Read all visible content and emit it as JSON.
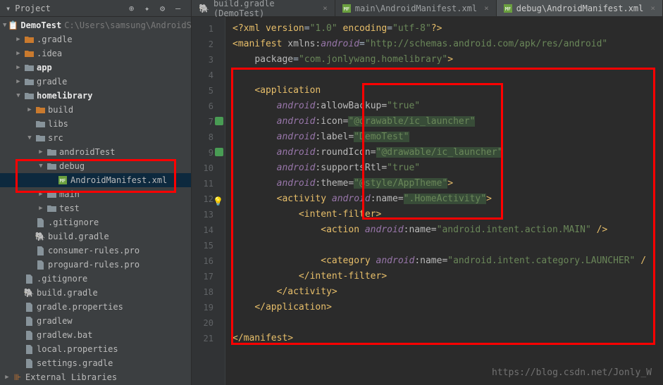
{
  "sidebar": {
    "title": "Project",
    "project": {
      "name": "DemoTest",
      "path": "C:\\Users\\samsung\\AndroidStu"
    },
    "nodes": [
      {
        "indent": 1,
        "arrow": "right",
        "icon": "folder-orange",
        "label": ".gradle"
      },
      {
        "indent": 1,
        "arrow": "right",
        "icon": "folder-orange",
        "label": ".idea"
      },
      {
        "indent": 1,
        "arrow": "right",
        "icon": "folder",
        "label": "app",
        "bold": true
      },
      {
        "indent": 1,
        "arrow": "right",
        "icon": "folder",
        "label": "gradle"
      },
      {
        "indent": 1,
        "arrow": "down",
        "icon": "folder",
        "label": "homelibrary",
        "bold": true
      },
      {
        "indent": 2,
        "arrow": "right",
        "icon": "folder-orange",
        "label": "build"
      },
      {
        "indent": 2,
        "arrow": "",
        "icon": "folder",
        "label": "libs"
      },
      {
        "indent": 2,
        "arrow": "down",
        "icon": "folder",
        "label": "src"
      },
      {
        "indent": 3,
        "arrow": "right",
        "icon": "folder",
        "label": "androidTest"
      },
      {
        "indent": 3,
        "arrow": "down",
        "icon": "folder",
        "label": "debug"
      },
      {
        "indent": 4,
        "arrow": "",
        "icon": "mf",
        "label": "AndroidManifest.xml",
        "selected": true
      },
      {
        "indent": 3,
        "arrow": "right",
        "icon": "folder",
        "label": "main"
      },
      {
        "indent": 3,
        "arrow": "right",
        "icon": "folder",
        "label": "test"
      },
      {
        "indent": 2,
        "arrow": "",
        "icon": "file",
        "label": ".gitignore"
      },
      {
        "indent": 2,
        "arrow": "",
        "icon": "gradle",
        "label": "build.gradle"
      },
      {
        "indent": 2,
        "arrow": "",
        "icon": "file",
        "label": "consumer-rules.pro"
      },
      {
        "indent": 2,
        "arrow": "",
        "icon": "file",
        "label": "proguard-rules.pro"
      },
      {
        "indent": 1,
        "arrow": "",
        "icon": "file",
        "label": ".gitignore"
      },
      {
        "indent": 1,
        "arrow": "",
        "icon": "gradle",
        "label": "build.gradle"
      },
      {
        "indent": 1,
        "arrow": "",
        "icon": "file",
        "label": "gradle.properties"
      },
      {
        "indent": 1,
        "arrow": "",
        "icon": "file",
        "label": "gradlew"
      },
      {
        "indent": 1,
        "arrow": "",
        "icon": "file",
        "label": "gradlew.bat"
      },
      {
        "indent": 1,
        "arrow": "",
        "icon": "file",
        "label": "local.properties"
      },
      {
        "indent": 1,
        "arrow": "",
        "icon": "file",
        "label": "settings.gradle"
      }
    ],
    "external": "External Libraries"
  },
  "tabs": [
    {
      "icon": "gradle",
      "label": "build.gradle (DemoTest)",
      "active": false
    },
    {
      "icon": "mf",
      "label": "main\\AndroidManifest.xml",
      "active": false
    },
    {
      "icon": "mf",
      "label": "debug\\AndroidManifest.xml",
      "active": true
    }
  ],
  "lines": [
    "1",
    "2",
    "3",
    "4",
    "5",
    "6",
    "7",
    "8",
    "9",
    "10",
    "11",
    "12",
    "13",
    "14",
    "15",
    "16",
    "17",
    "18",
    "19",
    "20",
    "21"
  ],
  "code": {
    "l1": {
      "p1": "<?",
      "p2": "xml version",
      "p3": "=",
      "p4": "\"1.0\"",
      "p5": " encoding",
      "p6": "=",
      "p7": "\"utf-8\"",
      "p8": "?>"
    },
    "l2": {
      "p1": "<",
      "p2": "manifest ",
      "p3": "xmlns:",
      "p4": "android",
      "p5": "=",
      "p6": "\"http://schemas.android.com/apk/res/android\""
    },
    "l3": {
      "p1": "package",
      "p2": "=",
      "p3": "\"com.jonlywang.homelibrary\"",
      "p4": ">"
    },
    "l5": {
      "p1": "<",
      "p2": "application"
    },
    "l6": {
      "p1": "android",
      "p2": ":allowBackup=",
      "p3": "\"true\""
    },
    "l7": {
      "p1": "android",
      "p2": ":icon=",
      "p3": "\"@drawable/ic_launcher\""
    },
    "l8": {
      "p1": "android",
      "p2": ":label=",
      "p3": "\"DemoTest\""
    },
    "l9": {
      "p1": "android",
      "p2": ":roundIcon=",
      "p3": "\"@drawable/ic_launcher\""
    },
    "l10": {
      "p1": "android",
      "p2": ":supportsRtl=",
      "p3": "\"true\""
    },
    "l11": {
      "p1": "android",
      "p2": ":theme=",
      "p3": "\"@style/AppTheme\"",
      "p4": ">"
    },
    "l12": {
      "p1": "<",
      "p2": "activity ",
      "p3": "android",
      "p4": ":name=",
      "p5": "\".HomeActivity\"",
      "p6": ">"
    },
    "l13": {
      "p1": "<",
      "p2": "intent-filter",
      "p3": ">"
    },
    "l14": {
      "p1": "<",
      "p2": "action ",
      "p3": "android",
      "p4": ":name=",
      "p5": "\"android.intent.action.MAIN\"",
      "p6": " />"
    },
    "l16": {
      "p1": "<",
      "p2": "category ",
      "p3": "android",
      "p4": ":name=",
      "p5": "\"android.intent.category.LAUNCHER\"",
      "p6": " /"
    },
    "l17": {
      "p1": "</",
      "p2": "intent-filter",
      "p3": ">"
    },
    "l18": {
      "p1": "</",
      "p2": "activity",
      "p3": ">"
    },
    "l19": {
      "p1": "</",
      "p2": "application",
      "p3": ">"
    },
    "l21": {
      "p1": "</",
      "p2": "manifest",
      "p3": ">"
    }
  },
  "watermark": "https://blog.csdn.net/Jonly_W"
}
